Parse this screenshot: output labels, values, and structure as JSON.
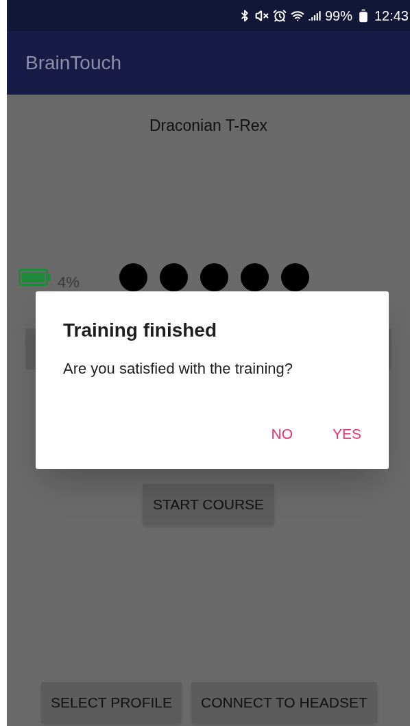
{
  "status_bar": {
    "battery": "99%",
    "time": "12:43"
  },
  "app_bar": {
    "title": "BrainTouch"
  },
  "profile_name": "Draconian T-Rex",
  "headset_battery": {
    "reading": "4%"
  },
  "signal_dots": [
    {
      "filled": true
    },
    {
      "filled": true
    },
    {
      "filled": true
    },
    {
      "filled": true
    },
    {
      "filled": true
    }
  ],
  "start_button": "START COURSE",
  "bottom_buttons": [
    "SELECT PROFILE",
    "CONNECT TO HEADSET"
  ],
  "dialog": {
    "title": "Training finished",
    "message": "Are you satisfied with the training?",
    "buttons": [
      "NO",
      "YES"
    ]
  }
}
